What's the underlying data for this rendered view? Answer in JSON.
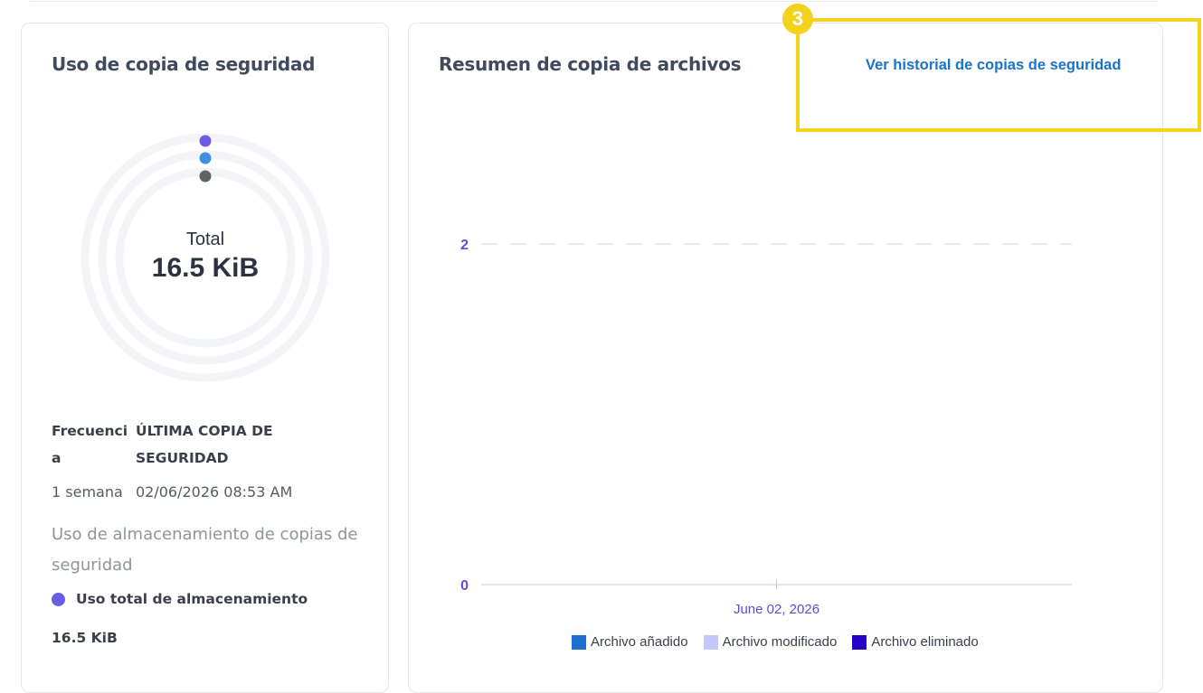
{
  "usage_card": {
    "title": "Uso de copia de seguridad",
    "donut": {
      "total_label": "Total",
      "total_value": "16.5 KiB",
      "ring_colors": [
        "#6b5de3",
        "#3d8fe0",
        "#5f6368"
      ]
    },
    "stats": {
      "frequency_header": "Frecuencia",
      "last_backup_header": "ÚLTIMA COPIA DE SEGURIDAD",
      "frequency_value": "1 semana",
      "last_backup_value": "02/06/2026 08:53 AM"
    },
    "storage_heading": "Uso de almacenamiento de copias de seguridad",
    "storage_legend_label": "Uso total de almacenamiento",
    "storage_legend_color": "#6b5de3",
    "storage_value": "16.5 KiB"
  },
  "summary_card": {
    "title": "Resumen de copia de archivos",
    "history_link": "Ver historial de copias de seguridad"
  },
  "chart_data": {
    "type": "bar",
    "categories": [
      "June 02, 2026"
    ],
    "series": [
      {
        "name": "Archivo añadido",
        "color": "#1f6fce",
        "values": [
          0
        ]
      },
      {
        "name": "Archivo modificado",
        "color": "#c3c8fb",
        "values": [
          0
        ]
      },
      {
        "name": "Archivo eliminado",
        "color": "#2400c9",
        "values": [
          0
        ]
      }
    ],
    "yticks": [
      "0",
      "2"
    ],
    "ylim": [
      0,
      2
    ],
    "grid": "dashed-horizontal",
    "legend_position": "bottom"
  },
  "annotation": {
    "badge_number": "3",
    "color": "#f2d21b"
  }
}
